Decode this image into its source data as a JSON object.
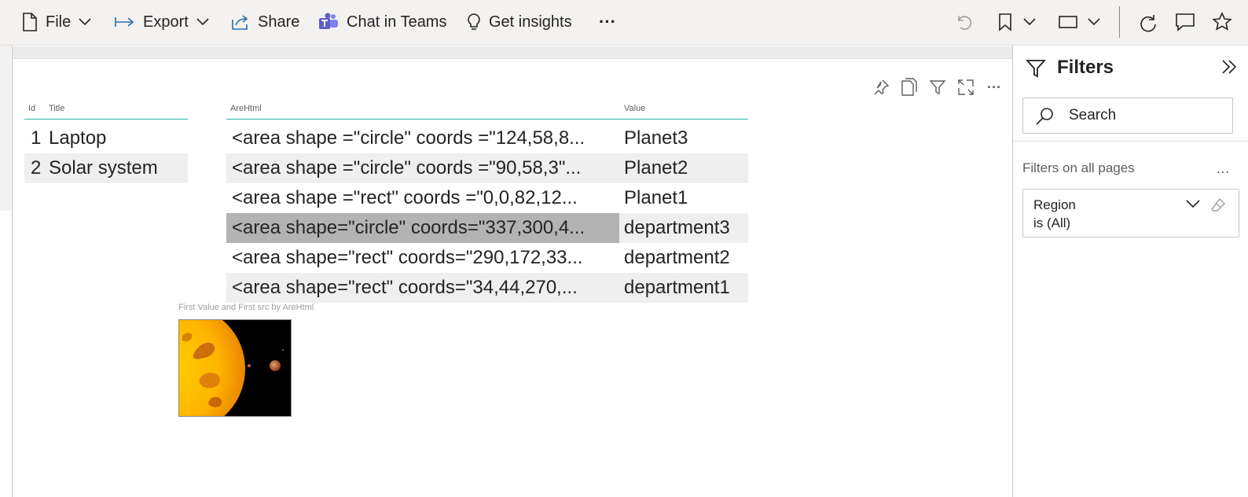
{
  "toolbar": {
    "file": "File",
    "export": "Export",
    "share": "Share",
    "teams": "Chat in Teams",
    "insights": "Get insights",
    "more": "···"
  },
  "table1": {
    "headers": [
      "Id",
      "Title"
    ],
    "rows": [
      {
        "id": "1",
        "title": "Laptop"
      },
      {
        "id": "2",
        "title": "Solar system"
      }
    ]
  },
  "table2": {
    "headers": [
      "AreHtml",
      "Value"
    ],
    "rows": [
      {
        "html": "<area shape =\"circle\" coords =\"124,58,8...",
        "value": "Planet3"
      },
      {
        "html": "<area shape =\"circle\" coords =\"90,58,3\"...",
        "value": "Planet2"
      },
      {
        "html": "<area shape =\"rect\" coords =\"0,0,82,12...",
        "value": "Planet1"
      },
      {
        "html": "<area shape=\"circle\" coords=\"337,300,4...",
        "value": "department3"
      },
      {
        "html": "<area shape=\"rect\" coords=\"290,172,33...",
        "value": "department2"
      },
      {
        "html": "<area shape=\"rect\" coords=\"34,44,270,...",
        "value": "department1"
      }
    ],
    "selected_row": 3
  },
  "image_visual": {
    "title": "First Value and First src by AreHtml"
  },
  "filters": {
    "title": "Filters",
    "search_placeholder": "Search",
    "section": "Filters on all pages",
    "section_more": "…",
    "card": {
      "name": "Region",
      "value": "is (All)"
    }
  },
  "colors": {
    "accent_underline": "#2bb5a6",
    "teams_icon": "#5b5fc7",
    "selected_row": "#b3b3b3"
  }
}
